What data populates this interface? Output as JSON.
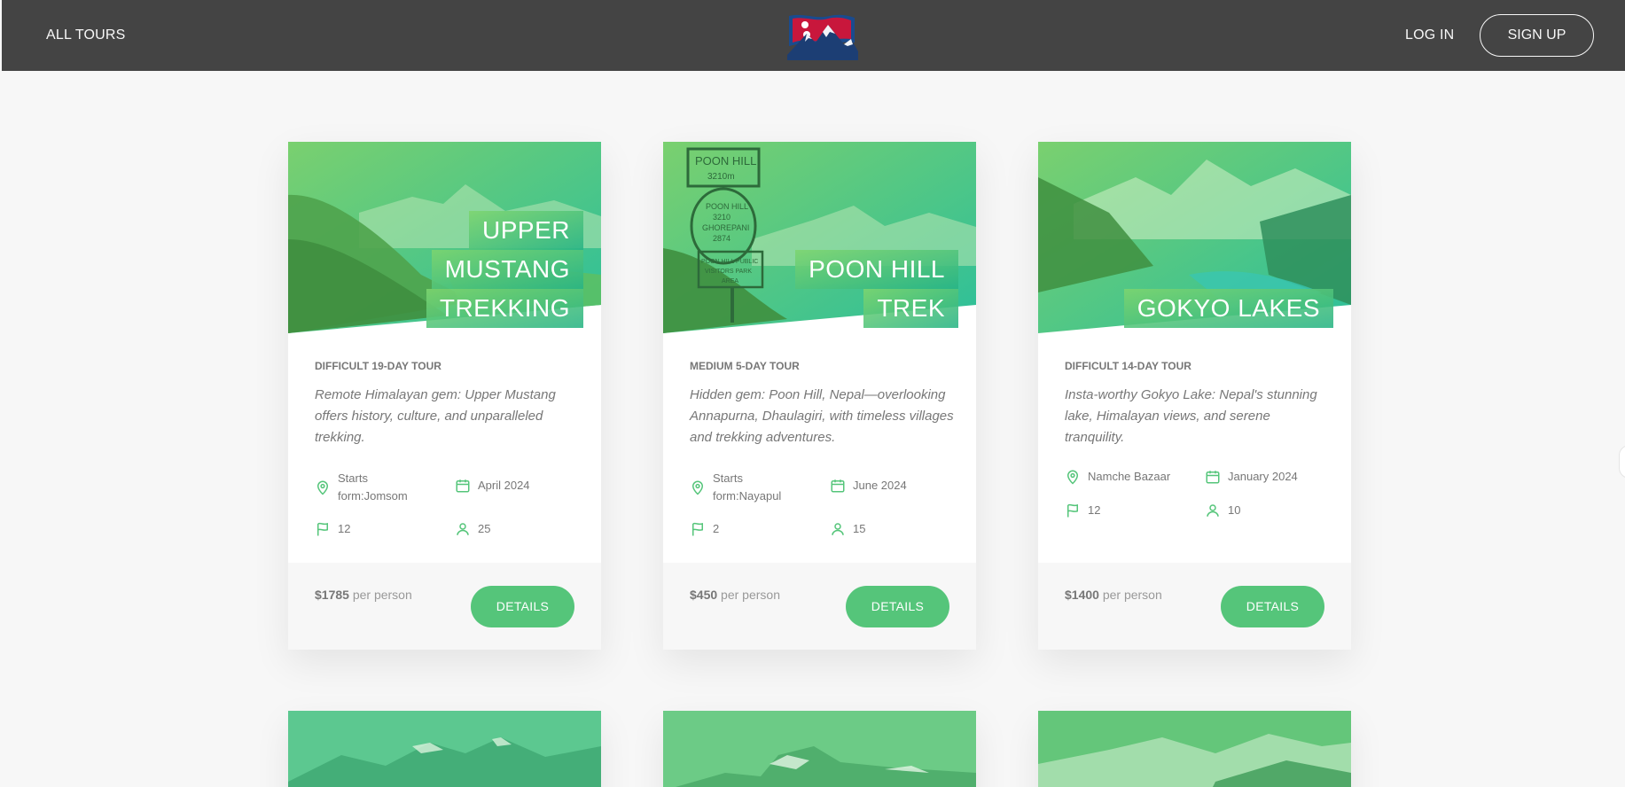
{
  "header": {
    "all_tours": "ALL TOURS",
    "log_in": "LOG IN",
    "sign_up": "SIGN UP"
  },
  "colors": {
    "accent": "#55c57a",
    "header_bg": "#444444",
    "page_bg": "#f7f7f7"
  },
  "tours": [
    {
      "title_lines": [
        "UPPER",
        "MUSTANG",
        "TREKKING"
      ],
      "sub_heading": "DIFFICULT 19-DAY TOUR",
      "summary": "Remote Himalayan gem: Upper Mustang offers history, culture, and unparalleled trekking.",
      "location": "Starts form:Jomsom",
      "date": "April 2024",
      "stops": "12",
      "people": "25",
      "price": "$1785",
      "price_unit": "per person",
      "button": "DETAILS"
    },
    {
      "title_lines": [
        "POON HILL",
        "TREK"
      ],
      "sub_heading": "MEDIUM 5-DAY TOUR",
      "summary": "Hidden gem: Poon Hill, Nepal—overlooking Annapurna, Dhaulagiri, with timeless villages and trekking adventures.",
      "location": "Starts form:Nayapul",
      "date": "June 2024",
      "stops": "2",
      "people": "15",
      "price": "$450",
      "price_unit": "per person",
      "button": "DETAILS",
      "sign_text": [
        "POON HILL",
        "3210m",
        "POON HILL",
        "3210",
        "GHOREPANI",
        "2874",
        "POON HILL PUBLIC",
        "VISITORS PARK",
        "AREA"
      ]
    },
    {
      "title_lines": [
        "GOKYO LAKES"
      ],
      "sub_heading": "DIFFICULT 14-DAY TOUR",
      "summary": "Insta-worthy Gokyo Lake: Nepal's stunning lake, Himalayan views, and serene tranquility.",
      "location": "Namche Bazaar",
      "date": "January 2024",
      "stops": "12",
      "people": "10",
      "price": "$1400",
      "price_unit": "per person",
      "button": "DETAILS"
    }
  ],
  "icons": {
    "location": "map-pin-icon",
    "date": "calendar-icon",
    "stops": "flag-icon",
    "people": "user-icon",
    "logo": "nepal-flag-mountain-logo"
  }
}
